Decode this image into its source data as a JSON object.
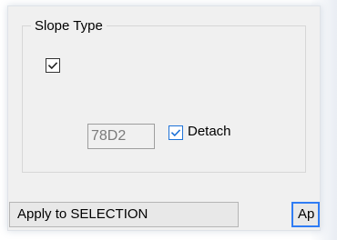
{
  "group": {
    "title": "Slope Type"
  },
  "controls": {
    "top_checkbox_checked": true,
    "field_value": "78D2",
    "detach_checked": true,
    "detach_label": "Detach"
  },
  "buttons": {
    "apply_selection_label": "Apply to SELECTION",
    "apply_cut_label": "Ap"
  },
  "colors": {
    "panel_background": "#f0f0f0",
    "focus_blue": "#2f7cf4",
    "detach_check_blue": "#1f73d8",
    "field_text": "#7b7b7b"
  }
}
